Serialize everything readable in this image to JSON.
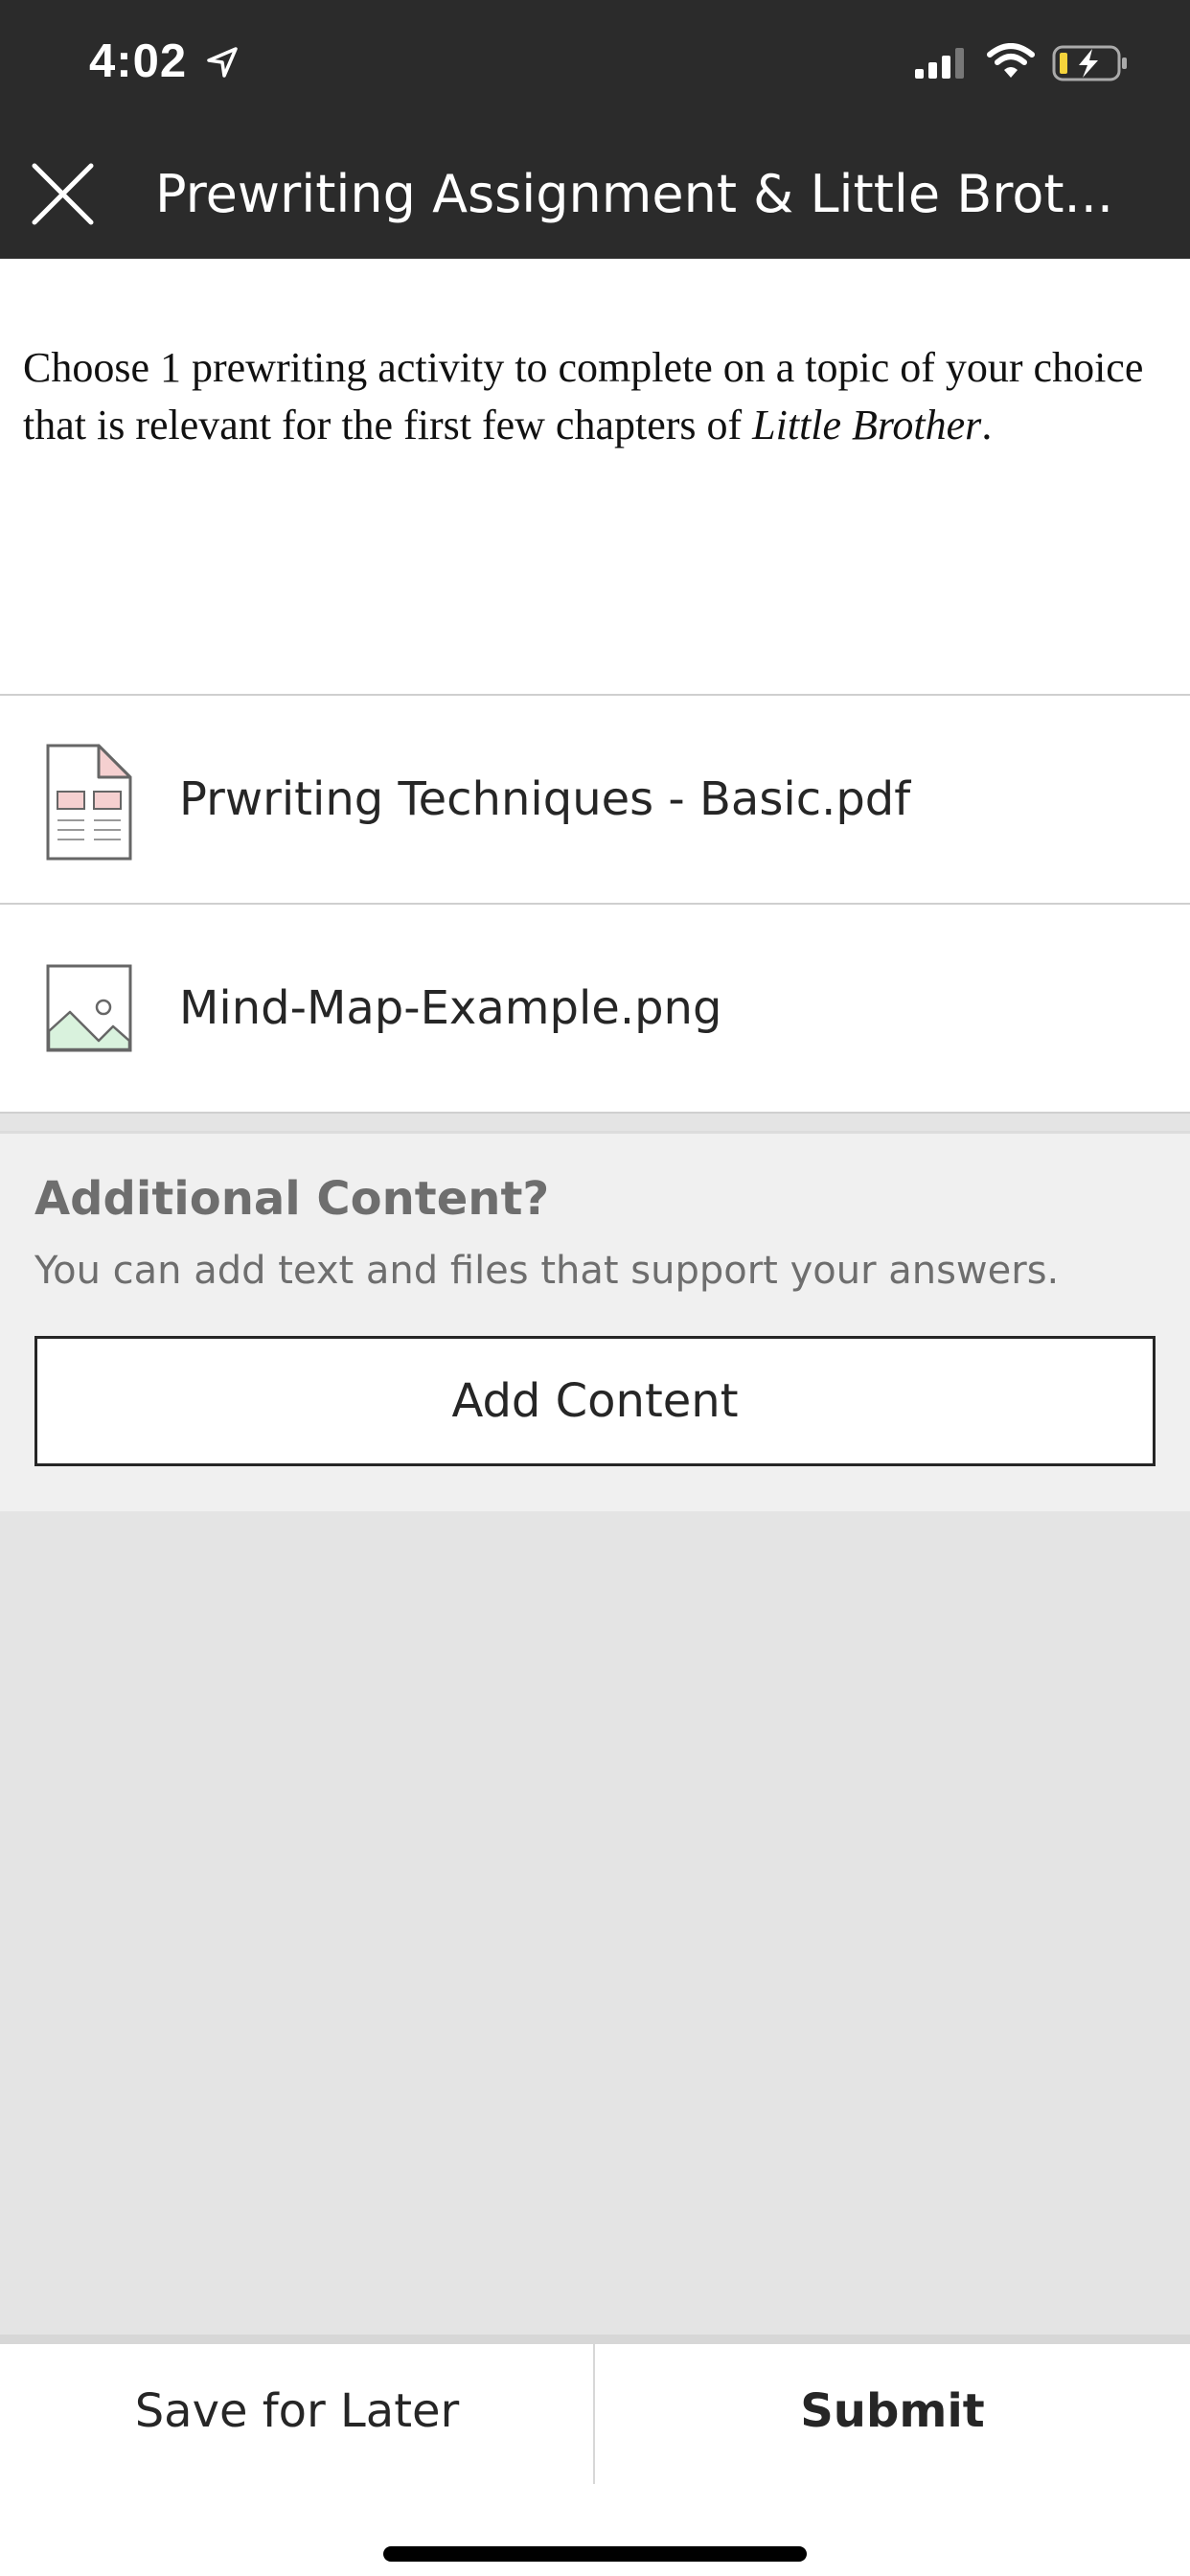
{
  "status_bar": {
    "time": "4:02",
    "icons": [
      "location-arrow-icon",
      "cellular-signal-icon",
      "wifi-icon",
      "battery-charging-icon"
    ]
  },
  "nav": {
    "close_icon": "close-icon",
    "title": "Prewriting Assignment & Little Brot..."
  },
  "instructions": {
    "text_part1": "Choose 1 prewriting activity to complete on a topic of your choice that is relevant for the first few chapters of ",
    "italic_title": "Little Brother",
    "text_part2": "."
  },
  "attachments": [
    {
      "name": "Prwriting Techniques - Basic.pdf",
      "icon": "pdf-document-icon"
    },
    {
      "name": "Mind-Map-Example.png",
      "icon": "image-file-icon"
    }
  ],
  "additional": {
    "heading": "Additional Content?",
    "subtext": "You can add text and files that support your answers.",
    "button_label": "Add Content"
  },
  "footer": {
    "save_label": "Save for Later",
    "submit_label": "Submit"
  },
  "colors": {
    "header_bg": "#2b2b2b",
    "page_bg": "#e4e4e4",
    "section_bg": "#f0f0f0",
    "text_dark": "#262626",
    "text_muted": "#6e6e6e",
    "pdf_accent": "#f5d0d0",
    "image_accent": "#d9f2dd"
  }
}
